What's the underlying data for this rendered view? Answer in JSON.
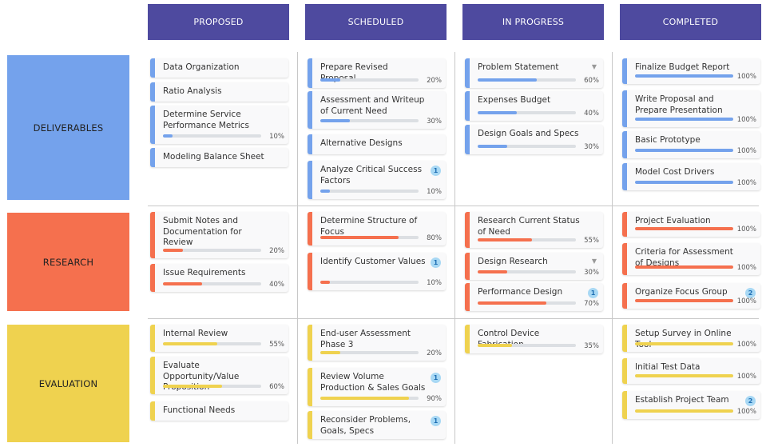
{
  "columns": [
    "PROPOSED",
    "SCHEDULED",
    "IN PROGRESS",
    "COMPLETED"
  ],
  "rows": [
    {
      "label": "DELIVERABLES",
      "color": "#74a2ec"
    },
    {
      "label": "RESEARCH",
      "color": "#f5704e"
    },
    {
      "label": "EVALUATION",
      "color": "#efd24f"
    }
  ],
  "cards": [
    {
      "title": "Data Organization",
      "row": 0,
      "col": 0
    },
    {
      "title": "Ratio Analysis",
      "row": 0,
      "col": 0
    },
    {
      "title": "Determine Service Performance Metrics",
      "row": 0,
      "col": 0,
      "progress": "10%"
    },
    {
      "title": "Modeling Balance Sheet",
      "row": 0,
      "col": 0
    },
    {
      "title": "Prepare Revised Proposal",
      "row": 0,
      "col": 1,
      "progress": "20%"
    },
    {
      "title": "Assessment and Writeup of Current Need",
      "row": 0,
      "col": 1,
      "progress": "30%"
    },
    {
      "title": "Alternative Designs",
      "row": 0,
      "col": 1
    },
    {
      "title": "Analyze Critical Success Factors",
      "row": 0,
      "col": 1,
      "progress": "10%",
      "badge": "1"
    },
    {
      "title": "Problem Statement",
      "row": 0,
      "col": 2,
      "progress": "60%",
      "caret": true
    },
    {
      "title": "Expenses Budget",
      "row": 0,
      "col": 2,
      "progress": "40%"
    },
    {
      "title": "Design Goals and Specs",
      "row": 0,
      "col": 2,
      "progress": "30%"
    },
    {
      "title": "Finalize Budget Report",
      "row": 0,
      "col": 3,
      "progress": "100%"
    },
    {
      "title": "Write Proposal and Prepare Presentation",
      "row": 0,
      "col": 3,
      "progress": "100%"
    },
    {
      "title": "Basic Prototype",
      "row": 0,
      "col": 3,
      "progress": "100%"
    },
    {
      "title": "Model Cost Drivers",
      "row": 0,
      "col": 3,
      "progress": "100%"
    },
    {
      "title": "Submit Notes and Documentation for Review",
      "row": 1,
      "col": 0,
      "progress": "20%"
    },
    {
      "title": "Issue Requirements",
      "row": 1,
      "col": 0,
      "progress": "40%"
    },
    {
      "title": "Determine Structure of Focus",
      "row": 1,
      "col": 1,
      "progress": "80%"
    },
    {
      "title": "Identify Customer Values",
      "row": 1,
      "col": 1,
      "progress": "10%",
      "badge": "1"
    },
    {
      "title": "Research Current Status of Need",
      "row": 1,
      "col": 2,
      "progress": "55%"
    },
    {
      "title": "Design Research",
      "row": 1,
      "col": 2,
      "progress": "30%",
      "caret": true
    },
    {
      "title": "Performance Design",
      "row": 1,
      "col": 2,
      "progress": "70%",
      "badge": "1"
    },
    {
      "title": "Project Evaluation",
      "row": 1,
      "col": 3,
      "progress": "100%"
    },
    {
      "title": "Criteria for Assessment of Designs",
      "row": 1,
      "col": 3,
      "progress": "100%"
    },
    {
      "title": "Organize Focus Group",
      "row": 1,
      "col": 3,
      "progress": "100%",
      "badge": "2"
    },
    {
      "title": "Internal Review",
      "row": 2,
      "col": 0,
      "progress": "55%"
    },
    {
      "title": "Evaluate Opportunity/Value Proposition",
      "row": 2,
      "col": 0,
      "progress": "60%"
    },
    {
      "title": "Functional Needs",
      "row": 2,
      "col": 0
    },
    {
      "title": "End-user Assessment Phase 3",
      "row": 2,
      "col": 1,
      "progress": "20%"
    },
    {
      "title": "Review Volume Production & Sales Goals",
      "row": 2,
      "col": 1,
      "progress": "90%",
      "badge": "1"
    },
    {
      "title": "Reconsider Problems, Goals, Specs",
      "row": 2,
      "col": 1,
      "badge": "1"
    },
    {
      "title": "Control Device Fabrication",
      "row": 2,
      "col": 2,
      "progress": "35%"
    },
    {
      "title": "Setup Survey in Online Tool",
      "row": 2,
      "col": 3,
      "progress": "100%"
    },
    {
      "title": "Initial Test Data",
      "row": 2,
      "col": 3,
      "progress": "100%"
    },
    {
      "title": "Establish Project Team",
      "row": 2,
      "col": 3,
      "progress": "100%",
      "badge": "2"
    }
  ]
}
